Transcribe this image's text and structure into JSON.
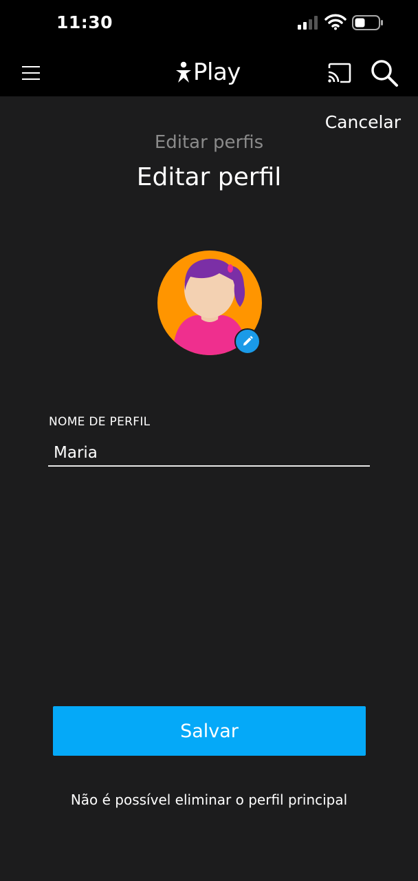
{
  "status_bar": {
    "time": "11:30",
    "icons": [
      "signal-icon",
      "wifi-icon",
      "battery-icon"
    ]
  },
  "header": {
    "app_name": "Play",
    "menu_icon": "hamburger-menu-icon",
    "cast_icon": "cast-icon",
    "search_icon": "search-icon"
  },
  "page": {
    "cancel_label": "Cancelar",
    "breadcrumb": "Editar perfis",
    "title": "Editar perfil"
  },
  "avatar": {
    "icon": "girl-avatar-icon",
    "edit_icon": "pencil-icon",
    "colors": {
      "background": "#ff9500",
      "hair": "#7b2fa6",
      "shirt": "#ef2f8e",
      "badge": "#1a9ae8"
    }
  },
  "form": {
    "name_label": "NOME DE PERFIL",
    "name_value": "Maria"
  },
  "actions": {
    "save_label": "Salvar",
    "accent": "#05a9f8"
  },
  "footnote": "Não é possível eliminar o perfil principal"
}
